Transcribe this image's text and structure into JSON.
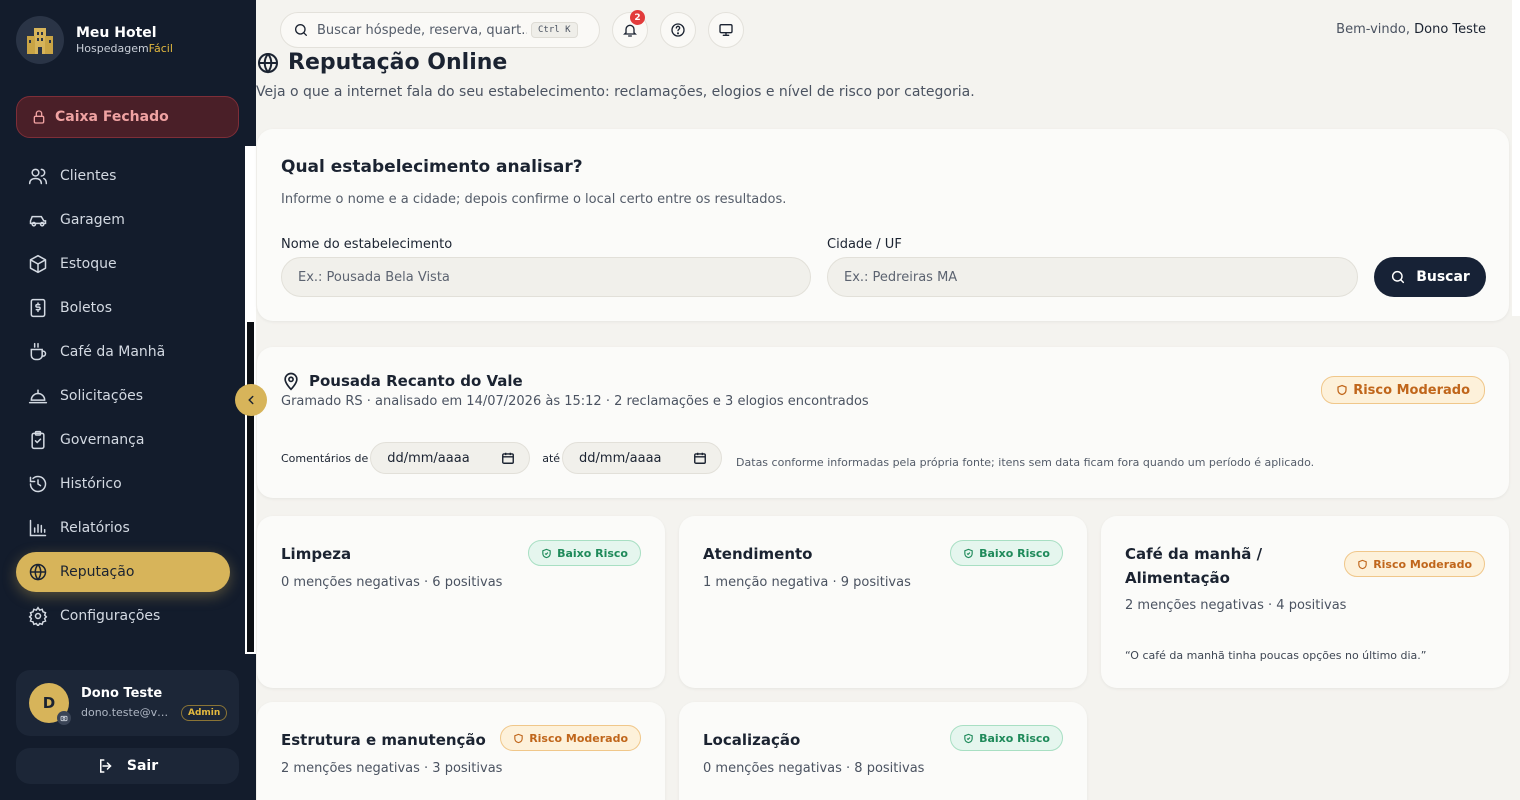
{
  "brand": {
    "name": "Meu Hotel",
    "sub_main": "Hospedagem",
    "sub_accent": "Fácil"
  },
  "cash": {
    "label": "Caixa Fechado"
  },
  "nav": [
    {
      "label": "Clientes",
      "icon": "users-icon"
    },
    {
      "label": "Garagem",
      "icon": "car-icon"
    },
    {
      "label": "Estoque",
      "icon": "box-icon"
    },
    {
      "label": "Boletos",
      "icon": "invoice-icon"
    },
    {
      "label": "Café da Manhã",
      "icon": "coffee-icon"
    },
    {
      "label": "Solicitações",
      "icon": "bell-service-icon"
    },
    {
      "label": "Governança",
      "icon": "clipboard-check-icon"
    },
    {
      "label": "Histórico",
      "icon": "history-icon"
    },
    {
      "label": "Relatórios",
      "icon": "bar-chart-icon"
    },
    {
      "label": "Reputação",
      "icon": "globe-icon",
      "active": true
    },
    {
      "label": "Configurações",
      "icon": "gear-icon"
    }
  ],
  "user": {
    "initial": "D",
    "name": "Dono Teste",
    "email": "dono.teste@va...",
    "role": "Admin"
  },
  "logout": {
    "label": "Sair"
  },
  "topbar": {
    "search_placeholder": "Buscar hóspede, reserva, quart...",
    "shortcut": "Ctrl K",
    "notifications": "2",
    "welcome_prefix": "Bem-vindo,",
    "welcome_name": "Dono Teste"
  },
  "page": {
    "title": "Reputação Online",
    "subtitle": "Veja o que a internet fala do seu estabelecimento: reclamações, elogios e nível de risco por categoria."
  },
  "search_card": {
    "title": "Qual estabelecimento analisar?",
    "hint": "Informe o nome e a cidade; depois confirme o local certo entre os resultados.",
    "name_label": "Nome do estabelecimento",
    "name_placeholder": "Ex.: Pousada Bela Vista",
    "city_label": "Cidade / UF",
    "city_placeholder": "Ex.: Pedreiras MA",
    "button": "Buscar"
  },
  "result": {
    "place": "Pousada Recanto do Vale",
    "meta": "Gramado RS · analisado em 14/07/2026 às 15:12 · 2 reclamações e 3 elogios encontrados",
    "risk": "Risco Moderado",
    "comments_label": "Comentários de",
    "until_label": "até",
    "date_placeholder": "dd/mm/aaaa",
    "date_note": "Datas conforme informadas pela própria fonte; itens sem data ficam fora quando um período é aplicado."
  },
  "categories": [
    {
      "name": "Limpeza",
      "counts": "0 menções negativas · 6 positivas",
      "risk": "Baixo Risco",
      "level": "low",
      "quote": ""
    },
    {
      "name": "Atendimento",
      "counts": "1 menção negativa · 9 positivas",
      "risk": "Baixo Risco",
      "level": "low",
      "quote": ""
    },
    {
      "name": "Café da manhã / Alimentação",
      "counts": "2 menções negativas · 4 positivas",
      "risk": "Risco Moderado",
      "level": "mod",
      "quote": "“O café da manhã tinha poucas opções no último dia.”"
    },
    {
      "name": "Estrutura e manutenção",
      "counts": "2 menções negativas · 3 positivas",
      "risk": "Risco Moderado",
      "level": "mod",
      "quote": ""
    },
    {
      "name": "Localização",
      "counts": "0 menções negativas · 8 positivas",
      "risk": "Baixo Risco",
      "level": "low",
      "quote": ""
    }
  ],
  "colors": {
    "sidebar": "#131c2c",
    "accent": "#d7b45a",
    "moderate": "#c0661b",
    "low": "#1f8a5a"
  }
}
